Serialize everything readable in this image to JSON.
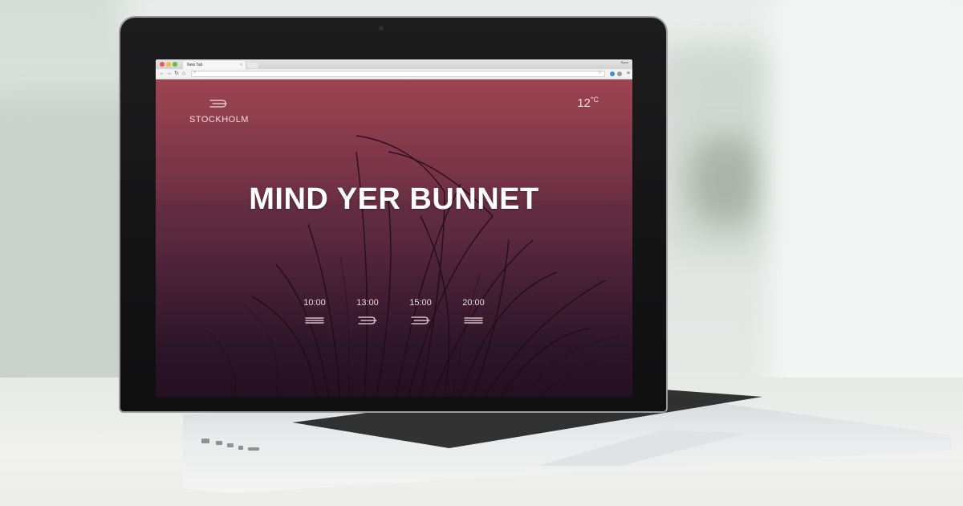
{
  "browser": {
    "tab_title": "New Tab",
    "tab_close": "×",
    "profile_label": "Ryan",
    "icons": [
      "back-arrow-icon",
      "forward-arrow-icon",
      "reload-icon",
      "home-icon",
      "search-icon",
      "star-icon"
    ]
  },
  "weather": {
    "city": "STOCKHOLM",
    "temperature": "12",
    "temperature_unit": "°C",
    "headline": "MIND YER BUNNET",
    "current_icon": "wind-icon",
    "forecast": [
      {
        "time": "10:00",
        "icon": "wind-icon"
      },
      {
        "time": "13:00",
        "icon": "strong-wind-icon"
      },
      {
        "time": "15:00",
        "icon": "strong-wind-icon"
      },
      {
        "time": "20:00",
        "icon": "wind-icon"
      }
    ]
  },
  "colors": {
    "page_top": "#9e4451",
    "page_bottom": "#241022",
    "text": "#f1dfe2"
  }
}
